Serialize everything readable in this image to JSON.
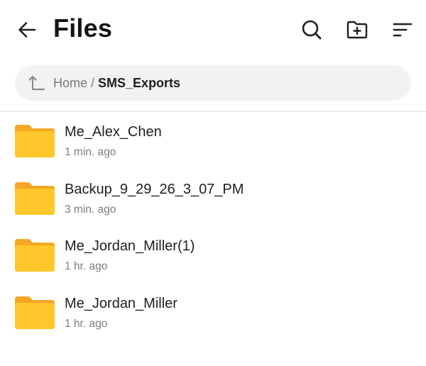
{
  "header": {
    "title": "Files",
    "back_icon": "arrow-left-icon",
    "search_icon": "search-icon",
    "new_folder_icon": "new-folder-icon",
    "sort_icon": "sort-icon"
  },
  "breadcrumb": {
    "up_icon": "up-arrow-icon",
    "home": "Home",
    "separator": "/",
    "current": "SMS_Exports"
  },
  "files": [
    {
      "name": "Me_Alex_Chen",
      "time": "1 min. ago",
      "icon": "folder-icon"
    },
    {
      "name": "Backup_9_29_26_3_07_PM",
      "time": "3 min. ago",
      "icon": "folder-icon"
    },
    {
      "name": "Me_Jordan_Miller(1)",
      "time": "1 hr. ago",
      "icon": "folder-icon"
    },
    {
      "name": "Me_Jordan_Miller",
      "time": "1 hr. ago",
      "icon": "folder-icon"
    }
  ],
  "colors": {
    "folder_front": "#FFC72C",
    "folder_back": "#F5A623",
    "pill_background": "#F2F2F2",
    "secondary_text": "#7D7D7D"
  }
}
